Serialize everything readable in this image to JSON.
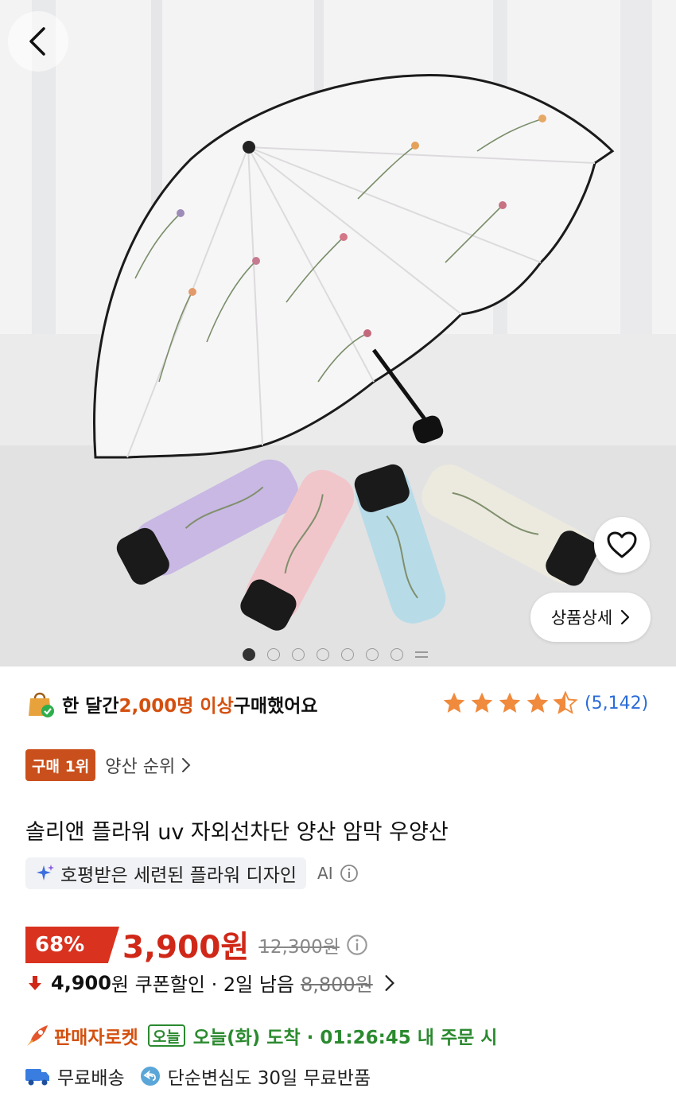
{
  "hero": {
    "image_alt": "floral umbrella with four folded umbrellas",
    "detail_button_label": "상품상세",
    "carousel": {
      "total_dots": 7,
      "active_index": 0
    }
  },
  "purchase": {
    "prefix": "한 달간 ",
    "highlight": "2,000명 이상",
    "suffix": " 구매했어요"
  },
  "rating": {
    "stars": 4.5,
    "count_label": "(5,142)"
  },
  "rank": {
    "badge": "구매 1위",
    "category_label": "양산 순위"
  },
  "product": {
    "title": "솔리앤 플라워 uv 자외선차단 양산 암막 우양산",
    "ai_summary": "호평받은 세련된 플라워 디자인",
    "ai_label": "AI"
  },
  "price": {
    "discount": "68%",
    "current": "3,900원",
    "original": "12,300원"
  },
  "coupon": {
    "amount": "4,900",
    "unit_text": "원 쿠폰할인 · 2일 남음",
    "original": "8,800원"
  },
  "delivery": {
    "seller_label": "판매자로켓",
    "today_badge": "오늘",
    "arrival_text": "오늘(화) 도착 · 01:26:45 내 주문 시"
  },
  "shipping": {
    "free_shipping": "무료배송",
    "free_return": "단순변심도 30일 무료반품"
  },
  "colors": {
    "accent_orange": "#d4500f",
    "price_red": "#d02818",
    "rating_blue": "#2a6bd8",
    "delivery_green": "#2b8a2f",
    "star": "#f08a3c"
  }
}
